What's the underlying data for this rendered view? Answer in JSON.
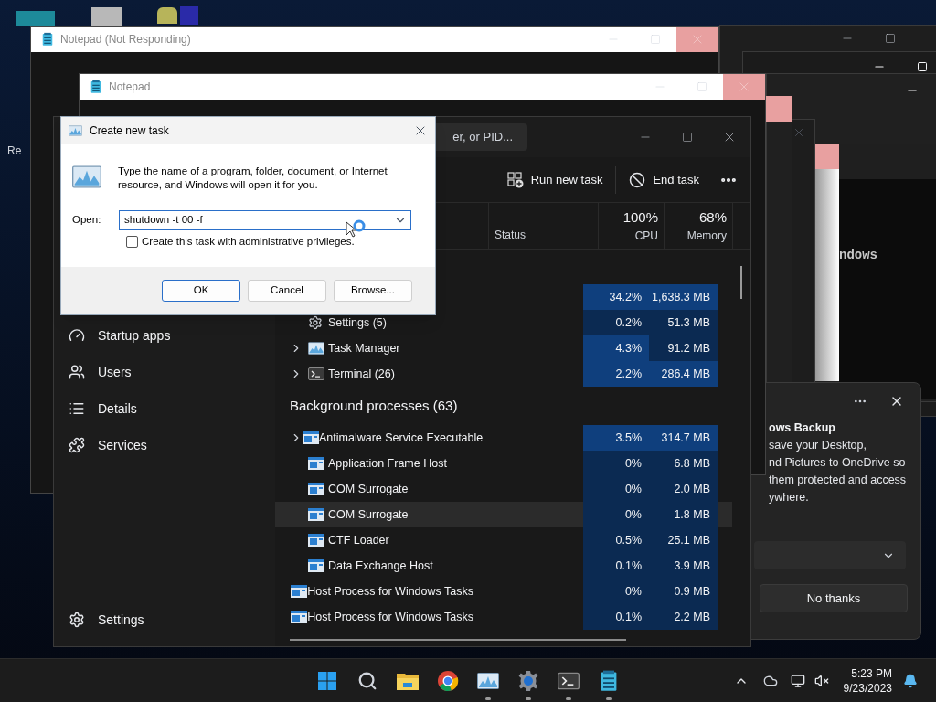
{
  "desktop": {
    "icon_label": "Re"
  },
  "notepad_windows": [
    {
      "title": "Notepad (Not Responding)"
    },
    {
      "title": "Notepad"
    }
  ],
  "console_window": {
    "text": "ndows"
  },
  "notification": {
    "title": "ows Backup",
    "body": [
      "save your Desktop,",
      "nd Pictures to OneDrive so",
      "them protected and access",
      "ywhere."
    ],
    "button": "No thanks"
  },
  "task_manager": {
    "search_placeholder": "er, or PID...",
    "sidebar": [
      {
        "label": "Startup apps",
        "kind": "startup"
      },
      {
        "label": "Users",
        "kind": "users"
      },
      {
        "label": "Details",
        "kind": "details"
      },
      {
        "label": "Services",
        "kind": "services"
      }
    ],
    "settings_label": "Settings",
    "toolbar": [
      {
        "label": "Run new task",
        "kind": "run"
      },
      {
        "label": "End task",
        "kind": "end"
      }
    ],
    "status_header": "Status",
    "cpu": {
      "percent": "100%",
      "label": "CPU"
    },
    "memory": {
      "percent": "68%",
      "label": "Memory"
    },
    "app_rows": [
      {
        "cpu": "34.2%",
        "memory": "1,638.3 MB",
        "cpu_hot": true,
        "mem_hot": true,
        "highlighted": false,
        "expandable": false
      },
      {
        "name": "Settings (5)",
        "kind": "settings",
        "cpu": "0.2%",
        "memory": "51.3 MB",
        "cpu_hot": false,
        "mem_hot": false,
        "highlighted": false,
        "expandable": false
      },
      {
        "name": "Task Manager",
        "kind": "taskmgr",
        "cpu": "4.3%",
        "memory": "91.2 MB",
        "cpu_hot": true,
        "mem_hot": false,
        "highlighted": false,
        "expandable": true
      },
      {
        "name": "Terminal (26)",
        "kind": "terminal",
        "cpu": "2.2%",
        "memory": "286.4 MB",
        "cpu_hot": true,
        "mem_hot": true,
        "highlighted": false,
        "expandable": true
      }
    ],
    "background_title": "Background processes (63)",
    "background_rows": [
      {
        "name": "Antimalware Service Executable",
        "kind": "process",
        "cpu": "3.5%",
        "memory": "314.7 MB",
        "cpu_hot": true,
        "mem_hot": true,
        "highlighted": false,
        "expandable": true
      },
      {
        "name": "Application Frame Host",
        "kind": "process",
        "cpu": "0%",
        "memory": "6.8 MB",
        "cpu_hot": false,
        "mem_hot": false,
        "highlighted": false,
        "expandable": false
      },
      {
        "name": "COM Surrogate",
        "kind": "process",
        "cpu": "0%",
        "memory": "2.0 MB",
        "cpu_hot": false,
        "mem_hot": false,
        "highlighted": false,
        "expandable": false
      },
      {
        "name": "COM Surrogate",
        "kind": "process",
        "cpu": "0%",
        "memory": "1.8 MB",
        "cpu_hot": false,
        "mem_hot": false,
        "highlighted": true,
        "expandable": false
      },
      {
        "name": "CTF Loader",
        "kind": "process",
        "cpu": "0.5%",
        "memory": "25.1 MB",
        "cpu_hot": false,
        "mem_hot": false,
        "highlighted": false,
        "expandable": false
      },
      {
        "name": "Data Exchange Host",
        "kind": "process",
        "cpu": "0.1%",
        "memory": "3.9 MB",
        "cpu_hot": false,
        "mem_hot": false,
        "highlighted": false,
        "expandable": false
      },
      {
        "name": "Host Process for Windows Tasks",
        "kind": "process",
        "cpu": "0%",
        "memory": "0.9 MB",
        "cpu_hot": false,
        "mem_hot": false,
        "highlighted": false,
        "expandable": false
      },
      {
        "name": "Host Process for Windows Tasks",
        "kind": "process",
        "cpu": "0.1%",
        "memory": "2.2 MB",
        "cpu_hot": false,
        "mem_hot": false,
        "highlighted": false,
        "expandable": false
      }
    ]
  },
  "dialog": {
    "title": "Create new task",
    "description": "Type the name of a program, folder, document, or Internet resource, and Windows will open it for you.",
    "open_label": "Open:",
    "value": "shutdown -t 00 -f",
    "admin_label": "Create this task with administrative privileges.",
    "admin_checked": false,
    "buttons": [
      {
        "label": "OK",
        "default": true
      },
      {
        "label": "Cancel",
        "default": false
      },
      {
        "label": "Browse...",
        "default": false
      }
    ]
  },
  "taskbar": {
    "apps": [
      {
        "kind": "start",
        "running": false
      },
      {
        "kind": "search",
        "running": false
      },
      {
        "kind": "folder",
        "running": false
      },
      {
        "kind": "browser",
        "running": false
      },
      {
        "kind": "taskmgr",
        "running": true
      },
      {
        "kind": "settings",
        "running": true
      },
      {
        "kind": "terminal",
        "running": true
      },
      {
        "kind": "notepad",
        "running": true
      }
    ],
    "time": "5:23 PM",
    "date": "9/23/2023"
  }
}
